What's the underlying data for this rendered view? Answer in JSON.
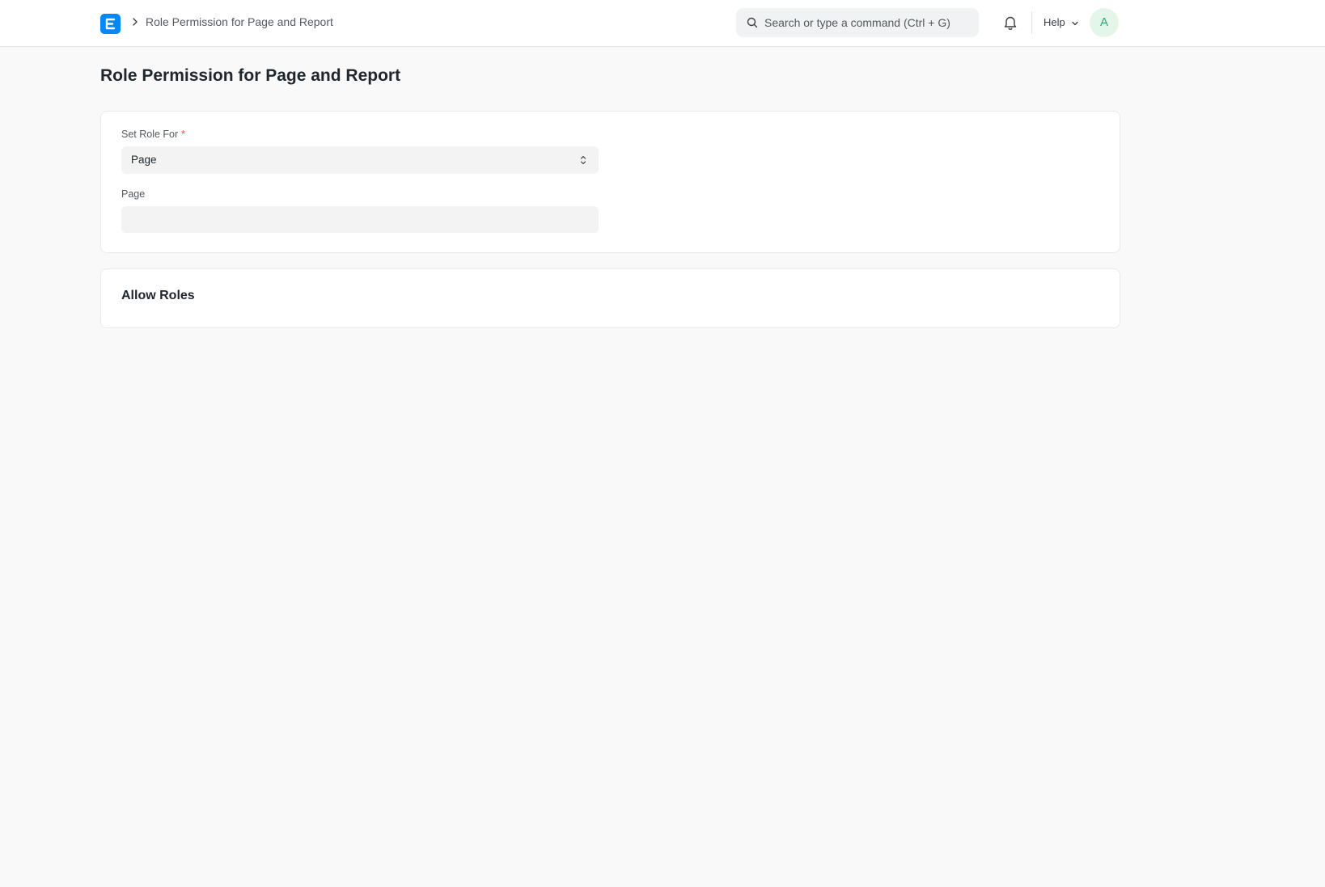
{
  "navbar": {
    "logo_icon": "erpnext-logo",
    "breadcrumb": [
      "Role Permission for Page and Report"
    ],
    "search": {
      "placeholder": "Search or type a command (Ctrl + G)"
    },
    "notification_icon": "bell-icon",
    "help_label": "Help",
    "avatar_initial": "A"
  },
  "page": {
    "title": "Role Permission for Page and Report"
  },
  "form": {
    "set_role_for": {
      "label": "Set Role For",
      "required_mark": "*",
      "value": "Page"
    },
    "page": {
      "label": "Page",
      "value": ""
    }
  },
  "section": {
    "allow_roles_title": "Allow Roles"
  },
  "colors": {
    "accent": "#0289f7",
    "background": "#f8f9f8",
    "avatar_bg": "#e4f5e9",
    "avatar_text": "#30a66d",
    "required": "#e24c4c"
  }
}
